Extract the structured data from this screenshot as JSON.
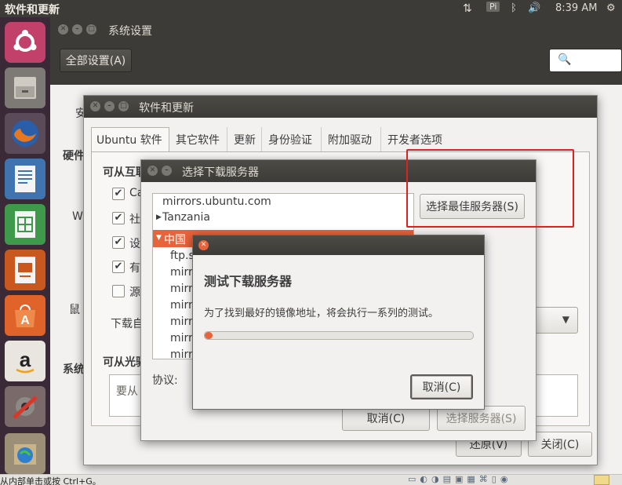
{
  "top_panel": {
    "app_title": "软件和更新",
    "keyboard_indicator": "Pi",
    "clock": "8:39 AM"
  },
  "system_settings": {
    "title": "系统设置",
    "all_settings_button": "全部设置(A)",
    "side_labels": [
      "安",
      "硬件",
      "W",
      "鼠",
      "系统"
    ]
  },
  "software_updates": {
    "title": "软件和更新",
    "tabs": [
      "Ubuntu 软件",
      "其它软件",
      "更新",
      "身份验证",
      "附加驱动",
      "开发者选项"
    ],
    "section_internet": "可从互联",
    "checkbox_labels": [
      "Ca",
      "社",
      "设",
      "有",
      "源"
    ],
    "checkbox_states": [
      true,
      true,
      true,
      true,
      false
    ],
    "download_from_label": "下载自",
    "section_cdrom": "可从光驱",
    "cdrom_placeholder": "要从",
    "revert_button": "还原(V)",
    "close_button": "关闭(C)"
  },
  "choose_server": {
    "title": "选择下载服务器",
    "list": {
      "top_item": "mirrors.ubuntu.com",
      "country_tanzania": "Tanzania",
      "country_china": "中国",
      "subitems": [
        "ftp.s",
        "mirr",
        "mirr",
        "mirr",
        "mirr",
        "mirr",
        "mirr"
      ]
    },
    "select_best_button": "选择最佳服务器(S)",
    "protocol_label": "协议:",
    "cancel_button": "取消(C)",
    "choose_button": "选择服务器(S)"
  },
  "test_dialog": {
    "heading": "测试下载服务器",
    "message": "为了找到最好的镜像地址，将会执行一系列的测试。",
    "progress_percent": 2,
    "cancel_button": "取消(C)"
  },
  "bottom_bar": {
    "status_text": "从内部单击或按 Ctrl+G。"
  },
  "colors": {
    "accent": "#e9633a",
    "panel": "#3c3b37",
    "highlight_box": "#e02020"
  }
}
